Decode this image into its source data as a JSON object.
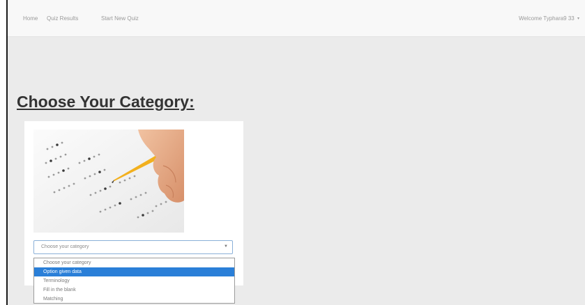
{
  "navbar": {
    "links": [
      {
        "label": "Home"
      },
      {
        "label": "Quiz Results"
      },
      {
        "label": "Start New Quiz"
      }
    ],
    "welcome": "Welcome Typhara9 33",
    "welcome_icon": "caret-down-icon"
  },
  "heading": "Choose Your Category:",
  "category": {
    "image": "quiz-answer-sheet-with-pencil",
    "select": {
      "value": "Choose your category",
      "arrow_icon": "chevron-down-icon"
    },
    "options": [
      {
        "label": "Choose your category",
        "selected": false
      },
      {
        "label": "Option given data",
        "selected": true
      },
      {
        "label": "Terminology",
        "selected": false
      },
      {
        "label": "Fill in the blank",
        "selected": false
      },
      {
        "label": "Matching",
        "selected": false
      }
    ]
  },
  "colors": {
    "page_background": "#ebebeb",
    "navbar_background": "#f8f8f8",
    "selected_option": "#2a7fd8",
    "heading_text": "#333333"
  }
}
